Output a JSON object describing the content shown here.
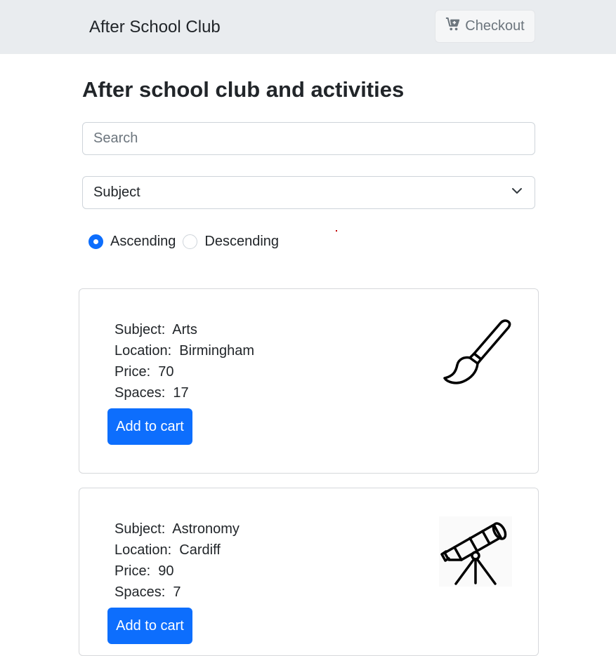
{
  "navbar": {
    "brand": "After School Club",
    "checkout_label": "Checkout",
    "checkout_icon": "cart-plus-icon"
  },
  "page": {
    "title": "After school club and activities"
  },
  "search": {
    "placeholder": "Search",
    "value": ""
  },
  "sort": {
    "subject_select_value": "Subject",
    "ascending_label": "Ascending",
    "descending_label": "Descending",
    "selected": "Ascending"
  },
  "lessons": [
    {
      "subject_label": "Subject:",
      "subject": "Arts",
      "location_label": "Location:",
      "location": "Birmingham",
      "price_label": "Price:",
      "price": "70",
      "spaces_label": "Spaces:",
      "spaces": "17",
      "button_label": "Add to cart",
      "icon": "paintbrush-icon"
    },
    {
      "subject_label": "Subject:",
      "subject": "Astronomy",
      "location_label": "Location:",
      "location": "Cardiff",
      "price_label": "Price:",
      "price": "90",
      "spaces_label": "Spaces:",
      "spaces": "7",
      "button_label": "Add to cart",
      "icon": "telescope-icon"
    }
  ],
  "colors": {
    "navbar_bg": "#e9ecef",
    "primary": "#0d6efd",
    "text": "#212529",
    "muted": "#6c757d"
  }
}
